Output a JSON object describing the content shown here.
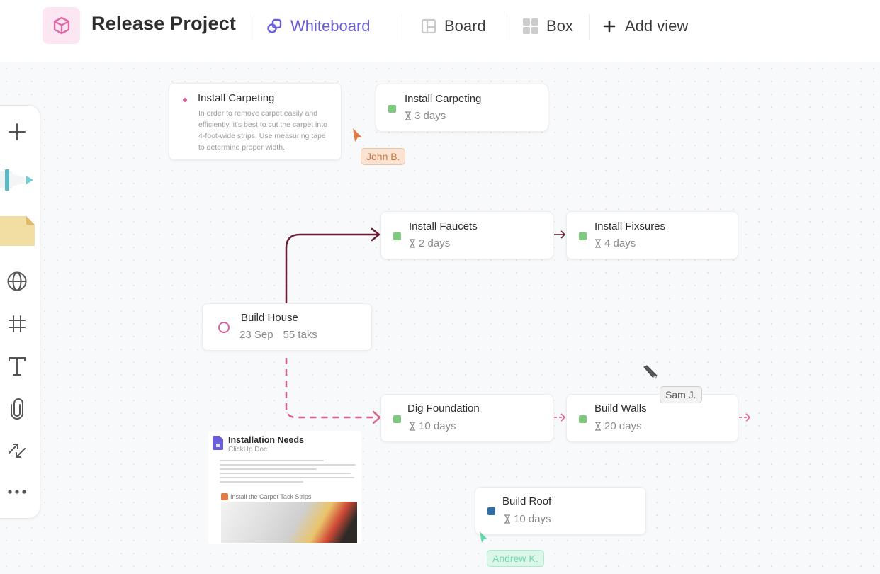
{
  "header": {
    "project_icon": "cube-icon",
    "project_title": "Release Project",
    "tabs": [
      {
        "label": "Whiteboard",
        "icon": "whiteboard-icon",
        "active": true
      },
      {
        "label": "Board",
        "icon": "board-icon",
        "active": false
      },
      {
        "label": "Box",
        "icon": "box-grid-icon",
        "active": false
      }
    ],
    "add_view_label": "Add view"
  },
  "toolbar": {
    "tools": [
      {
        "name": "add",
        "icon": "plus-icon"
      },
      {
        "name": "pen",
        "icon": "marker-icon"
      },
      {
        "name": "sticky-note",
        "icon": "sticky-note-icon"
      },
      {
        "name": "web",
        "icon": "globe-icon"
      },
      {
        "name": "frame",
        "icon": "frame-hash-icon"
      },
      {
        "name": "text",
        "icon": "text-icon"
      },
      {
        "name": "attach",
        "icon": "paperclip-icon"
      },
      {
        "name": "connector",
        "icon": "connector-arrows-icon"
      },
      {
        "name": "more",
        "icon": "more-dots-icon"
      }
    ]
  },
  "canvas": {
    "note": {
      "title": "Install Carpeting",
      "body": "In order to remove carpet easily and efficiently, it's best to cut the carpet into 4-foot-wide strips. Use measuring tape to determine proper width.",
      "dot_color": "#d9609e"
    },
    "tasks": [
      {
        "id": "install-carpeting",
        "title": "Install Carpeting",
        "duration": "3 days",
        "status_color": "#7ec97e"
      },
      {
        "id": "install-faucets",
        "title": "Install Faucets",
        "duration": "2 days",
        "status_color": "#7ec97e"
      },
      {
        "id": "install-fixsures",
        "title": "Install Fixsures",
        "duration": "4 days",
        "status_color": "#7ec97e"
      },
      {
        "id": "dig-foundation",
        "title": "Dig Foundation",
        "duration": "10 days",
        "status_color": "#7ec97e"
      },
      {
        "id": "build-walls",
        "title": "Build Walls",
        "duration": "20 days",
        "status_color": "#7ec97e"
      },
      {
        "id": "build-roof",
        "title": "Build Roof",
        "duration": "10 days",
        "status_color": "#2f6da3"
      }
    ],
    "project_node": {
      "title": "Build House",
      "date": "23 Sep",
      "tasks_count": "55 taks",
      "ring_color": "#d9609e"
    },
    "doc": {
      "title": "Installation Needs",
      "subtitle": "ClickUp Doc",
      "section_title": "Install the Carpet Tack Strips",
      "icon_color": "#6a5fd6"
    },
    "collaborators": [
      {
        "name": "John B.",
        "color": "#e07b46"
      },
      {
        "name": "Sam J.",
        "color": "#555555"
      },
      {
        "name": "Andrew K.",
        "color": "#5fd9a6"
      }
    ],
    "connector_colors": {
      "solid": "#6b1d33",
      "dashed": "#d9608a"
    }
  }
}
